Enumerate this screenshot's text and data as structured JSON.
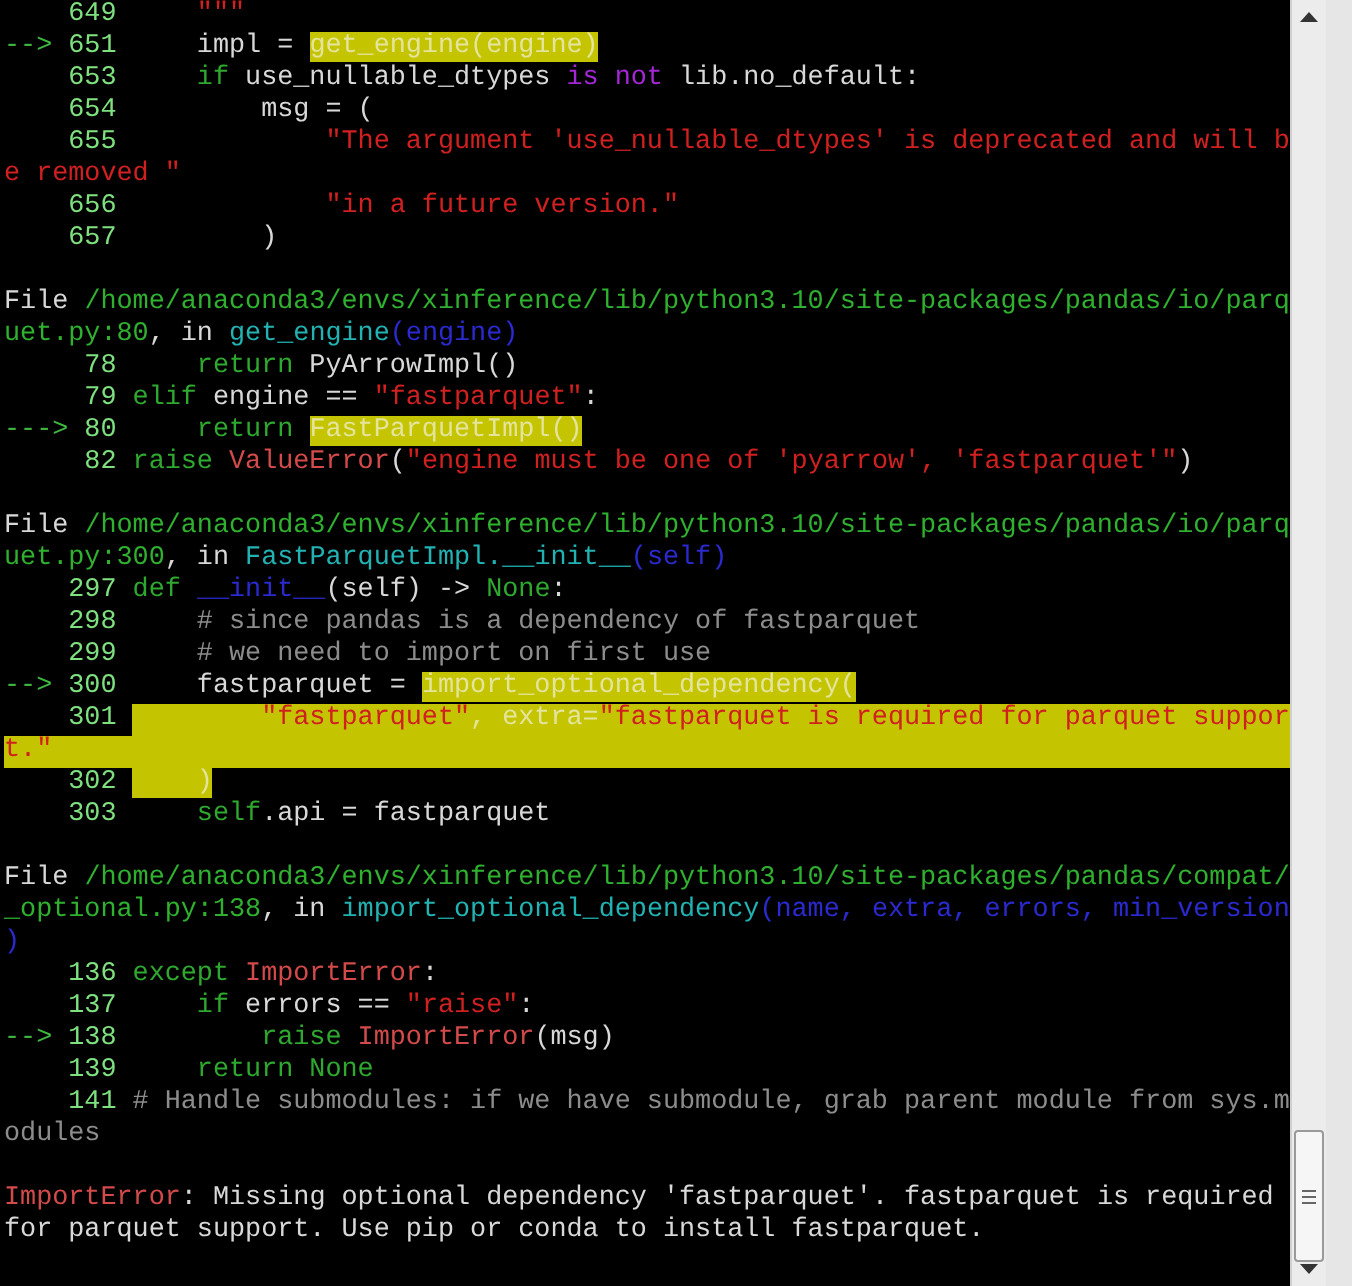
{
  "terminal": {
    "rows": [
      {
        "kind": "code",
        "number": "649",
        "segments": [
          {
            "text": "    \"\"\"",
            "kind": "string"
          }
        ]
      },
      {
        "kind": "code",
        "arrow": "-->",
        "number": "651",
        "segments": [
          {
            "text": "    impl = ",
            "kind": "plain"
          },
          {
            "text": "get_engine(engine)",
            "kind": "hl"
          }
        ]
      },
      {
        "kind": "code",
        "number": "653",
        "segments": [
          {
            "text": "    if",
            "kind": "keyword"
          },
          {
            "text": " use_nullable_dtypes ",
            "kind": "plain"
          },
          {
            "text": "is not",
            "kind": "operator"
          },
          {
            "text": " lib.no_default:",
            "kind": "plain"
          }
        ]
      },
      {
        "kind": "code",
        "number": "654",
        "segments": [
          {
            "text": "        msg = (",
            "kind": "plain"
          }
        ]
      },
      {
        "kind": "code",
        "number": "655",
        "segments": [
          {
            "text": "            \"The argument 'use_nullable_dtypes' is deprecated and will b",
            "kind": "string"
          }
        ]
      },
      {
        "kind": "cont",
        "segments": [
          {
            "text": "e removed \"",
            "kind": "string"
          }
        ]
      },
      {
        "kind": "code",
        "number": "656",
        "segments": [
          {
            "text": "            \"in a future version.\"",
            "kind": "string"
          }
        ]
      },
      {
        "kind": "code",
        "number": "657",
        "segments": [
          {
            "text": "        )",
            "kind": "plain"
          }
        ]
      },
      {
        "kind": "blank"
      },
      {
        "kind": "header",
        "segments": [
          {
            "text": "File ",
            "kind": "plain"
          },
          {
            "text": "/home/anaconda3/envs/xinference/lib/python3.10/site-packages/pandas/io/parq",
            "kind": "path"
          }
        ]
      },
      {
        "kind": "header",
        "segments": [
          {
            "text": "uet.py:80",
            "kind": "path"
          },
          {
            "text": ", in ",
            "kind": "plain"
          },
          {
            "text": "get_engine",
            "kind": "func"
          },
          {
            "text": "(engine)",
            "kind": "args"
          }
        ]
      },
      {
        "kind": "code",
        "number": "78",
        "segments": [
          {
            "text": "    return",
            "kind": "keyword"
          },
          {
            "text": " PyArrowImpl()",
            "kind": "plain"
          }
        ]
      },
      {
        "kind": "code",
        "number": "79",
        "segments": [
          {
            "text": "elif",
            "kind": "keyword"
          },
          {
            "text": " engine == ",
            "kind": "plain"
          },
          {
            "text": "\"fastparquet\"",
            "kind": "string"
          },
          {
            "text": ":",
            "kind": "plain"
          }
        ]
      },
      {
        "kind": "code",
        "arrow": "--->",
        "number": "80",
        "segments": [
          {
            "text": "    return ",
            "kind": "keyword"
          },
          {
            "text": "FastParquetImpl()",
            "kind": "hl"
          }
        ]
      },
      {
        "kind": "code",
        "number": "82",
        "segments": [
          {
            "text": "raise",
            "kind": "keyword"
          },
          {
            "text": " ValueError",
            "kind": "exception"
          },
          {
            "text": "(",
            "kind": "plain"
          },
          {
            "text": "\"engine must be one of 'pyarrow', 'fastparquet'\"",
            "kind": "string"
          },
          {
            "text": ")",
            "kind": "plain"
          }
        ]
      },
      {
        "kind": "blank"
      },
      {
        "kind": "header",
        "segments": [
          {
            "text": "File ",
            "kind": "plain"
          },
          {
            "text": "/home/anaconda3/envs/xinference/lib/python3.10/site-packages/pandas/io/parq",
            "kind": "path"
          }
        ]
      },
      {
        "kind": "header",
        "segments": [
          {
            "text": "uet.py:300",
            "kind": "path"
          },
          {
            "text": ", in ",
            "kind": "plain"
          },
          {
            "text": "FastParquetImpl.__init__",
            "kind": "func"
          },
          {
            "text": "(self)",
            "kind": "args"
          }
        ]
      },
      {
        "kind": "code",
        "number": "297",
        "segments": [
          {
            "text": "def ",
            "kind": "keyword"
          },
          {
            "text": "__init__",
            "kind": "args"
          },
          {
            "text": "(self) -> ",
            "kind": "plain"
          },
          {
            "text": "None",
            "kind": "keyword"
          },
          {
            "text": ":",
            "kind": "plain"
          }
        ]
      },
      {
        "kind": "code",
        "number": "298",
        "segments": [
          {
            "text": "    # since pandas is a dependency of fastparquet",
            "kind": "comment"
          }
        ]
      },
      {
        "kind": "code",
        "number": "299",
        "segments": [
          {
            "text": "    # we need to import on first use",
            "kind": "comment"
          }
        ]
      },
      {
        "kind": "code",
        "arrow": "-->",
        "number": "300",
        "segments": [
          {
            "text": "    fastparquet = ",
            "kind": "plain"
          },
          {
            "text": "import_optional_dependency(",
            "kind": "hl"
          }
        ]
      },
      {
        "kind": "code",
        "number": "301",
        "highlighted": true,
        "segments": [
          {
            "text": "        \"fastparquet\"",
            "kind": "hl_string"
          },
          {
            "text": ", extra=",
            "kind": "hl"
          },
          {
            "text": "\"fastparquet is required for parquet suppor",
            "kind": "hl_string"
          }
        ]
      },
      {
        "kind": "cont",
        "highlighted": true,
        "segments": [
          {
            "text": "t.\"",
            "kind": "hl_string"
          }
        ]
      },
      {
        "kind": "code",
        "number": "302",
        "segments": [
          {
            "text": "    )",
            "kind": "hl"
          }
        ]
      },
      {
        "kind": "code",
        "number": "303",
        "segments": [
          {
            "text": "    self",
            "kind": "keyword"
          },
          {
            "text": ".api = fastparquet",
            "kind": "plain"
          }
        ]
      },
      {
        "kind": "blank"
      },
      {
        "kind": "header",
        "segments": [
          {
            "text": "File ",
            "kind": "plain"
          },
          {
            "text": "/home/anaconda3/envs/xinference/lib/python3.10/site-packages/pandas/compat/",
            "kind": "path"
          }
        ]
      },
      {
        "kind": "header",
        "segments": [
          {
            "text": "_optional.py:138",
            "kind": "path"
          },
          {
            "text": ", in ",
            "kind": "plain"
          },
          {
            "text": "import_optional_dependency",
            "kind": "func"
          },
          {
            "text": "(name, extra, errors, min_version",
            "kind": "args"
          }
        ]
      },
      {
        "kind": "header",
        "segments": [
          {
            "text": ")",
            "kind": "args"
          }
        ]
      },
      {
        "kind": "code",
        "number": "136",
        "segments": [
          {
            "text": "except ",
            "kind": "keyword"
          },
          {
            "text": "ImportError",
            "kind": "exception"
          },
          {
            "text": ":",
            "kind": "plain"
          }
        ]
      },
      {
        "kind": "code",
        "number": "137",
        "segments": [
          {
            "text": "    if",
            "kind": "keyword"
          },
          {
            "text": " errors == ",
            "kind": "plain"
          },
          {
            "text": "\"raise\"",
            "kind": "string"
          },
          {
            "text": ":",
            "kind": "plain"
          }
        ]
      },
      {
        "kind": "code",
        "arrow": "-->",
        "number": "138",
        "segments": [
          {
            "text": "        raise ",
            "kind": "keyword"
          },
          {
            "text": "ImportError",
            "kind": "exception"
          },
          {
            "text": "(msg)",
            "kind": "plain"
          }
        ]
      },
      {
        "kind": "code",
        "number": "139",
        "segments": [
          {
            "text": "    return None",
            "kind": "keyword"
          }
        ]
      },
      {
        "kind": "code",
        "number": "141",
        "segments": [
          {
            "text": "# Handle submodules: if we have submodule, grab parent module from sys.m",
            "kind": "comment"
          }
        ]
      },
      {
        "kind": "cont",
        "segments": [
          {
            "text": "odules",
            "kind": "comment"
          }
        ]
      },
      {
        "kind": "blank"
      },
      {
        "kind": "message",
        "segments": [
          {
            "text": "ImportError",
            "kind": "exception"
          },
          {
            "text": ": Missing optional dependency 'fastparquet'. fastparquet is required",
            "kind": "plain"
          }
        ]
      },
      {
        "kind": "message",
        "segments": [
          {
            "text": "for parquet support. Use pip or conda to install fastparquet.",
            "kind": "plain"
          }
        ]
      }
    ]
  }
}
